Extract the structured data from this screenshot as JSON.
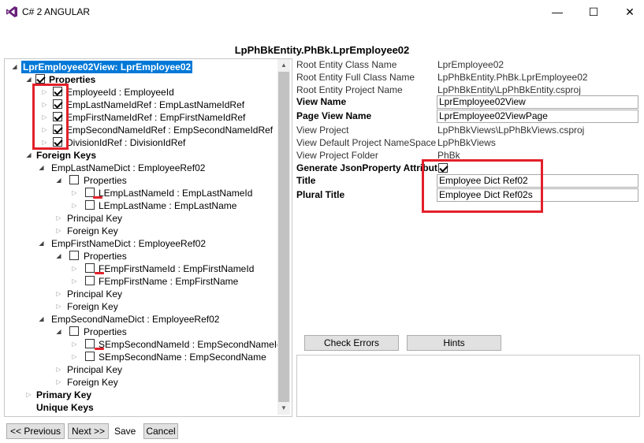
{
  "window": {
    "title": "C# 2 ANGULAR",
    "minimize": "—",
    "maximize": "☐",
    "close": "✕"
  },
  "page_heading": "LpPhBkEntity.PhBk.LprEmployee02",
  "tree": {
    "root": "LprEmployee02View: LprEmployee02",
    "properties": "Properties",
    "prop_items": [
      "EmployeeId : EmployeeId",
      "EmpLastNameIdRef : EmpLastNameIdRef",
      "EmpFirstNameIdRef : EmpFirstNameIdRef",
      "EmpSecondNameIdRef : EmpSecondNameIdRef",
      "DivisionIdRef : DivisionIdRef"
    ],
    "foreign_keys": "Foreign Keys",
    "fk1": {
      "name": "EmpLastNameDict : EmployeeRef02",
      "properties": "Properties",
      "items": [
        "LEmpLastNameId : EmpLastNameId",
        "LEmpLastName : EmpLastName"
      ],
      "principal_key": "Principal Key",
      "foreign_key": "Foreign Key"
    },
    "fk2": {
      "name": "EmpFirstNameDict : EmployeeRef02",
      "properties": "Properties",
      "items": [
        "FEmpFirstNameId : EmpFirstNameId",
        "FEmpFirstName : EmpFirstName"
      ],
      "principal_key": "Principal Key",
      "foreign_key": "Foreign Key"
    },
    "fk3": {
      "name": "EmpSecondNameDict : EmployeeRef02",
      "properties": "Properties",
      "items": [
        "SEmpSecondNameId : EmpSecondNameId",
        "SEmpSecondName : EmpSecondName"
      ],
      "principal_key": "Principal Key",
      "foreign_key": "Foreign Key"
    },
    "primary_key": "Primary Key",
    "unique_keys": "Unique Keys"
  },
  "props": {
    "root_class_label": "Root Entity Class Name",
    "root_class_value": "LprEmployee02",
    "root_full_label": "Root Entity Full Class Name",
    "root_full_value": "LpPhBkEntity.PhBk.LprEmployee02",
    "root_project_label": "Root Entity Project Name",
    "root_project_value": "LpPhBkEntity\\LpPhBkEntity.csproj",
    "view_name_label": "View Name",
    "view_name_value": "LprEmployee02View",
    "page_view_label": "Page View Name",
    "page_view_value": "LprEmployee02ViewPage",
    "view_project_label": "View Project",
    "view_project_value": "LpPhBkViews\\LpPhBkViews.csproj",
    "default_ns_label": "View Default Project NameSpace",
    "default_ns_value": "LpPhBkViews",
    "project_folder_label": "View Project Folder",
    "project_folder_value": "PhBk",
    "gen_json_label": "Generate JsonProperty Attribut",
    "title_label": "Title",
    "title_value": "Employee Dict Ref02",
    "plural_label": "Plural Title",
    "plural_value": "Employee Dict Ref02s"
  },
  "buttons": {
    "check_errors": "Check Errors",
    "hints": "Hints",
    "previous": "<< Previous",
    "next": "Next >>",
    "save": "Save",
    "cancel": "Cancel"
  },
  "colors": {
    "selection": "#0078d7",
    "highlight_red": "#e2202a",
    "button_bg": "#e1e1e1"
  }
}
